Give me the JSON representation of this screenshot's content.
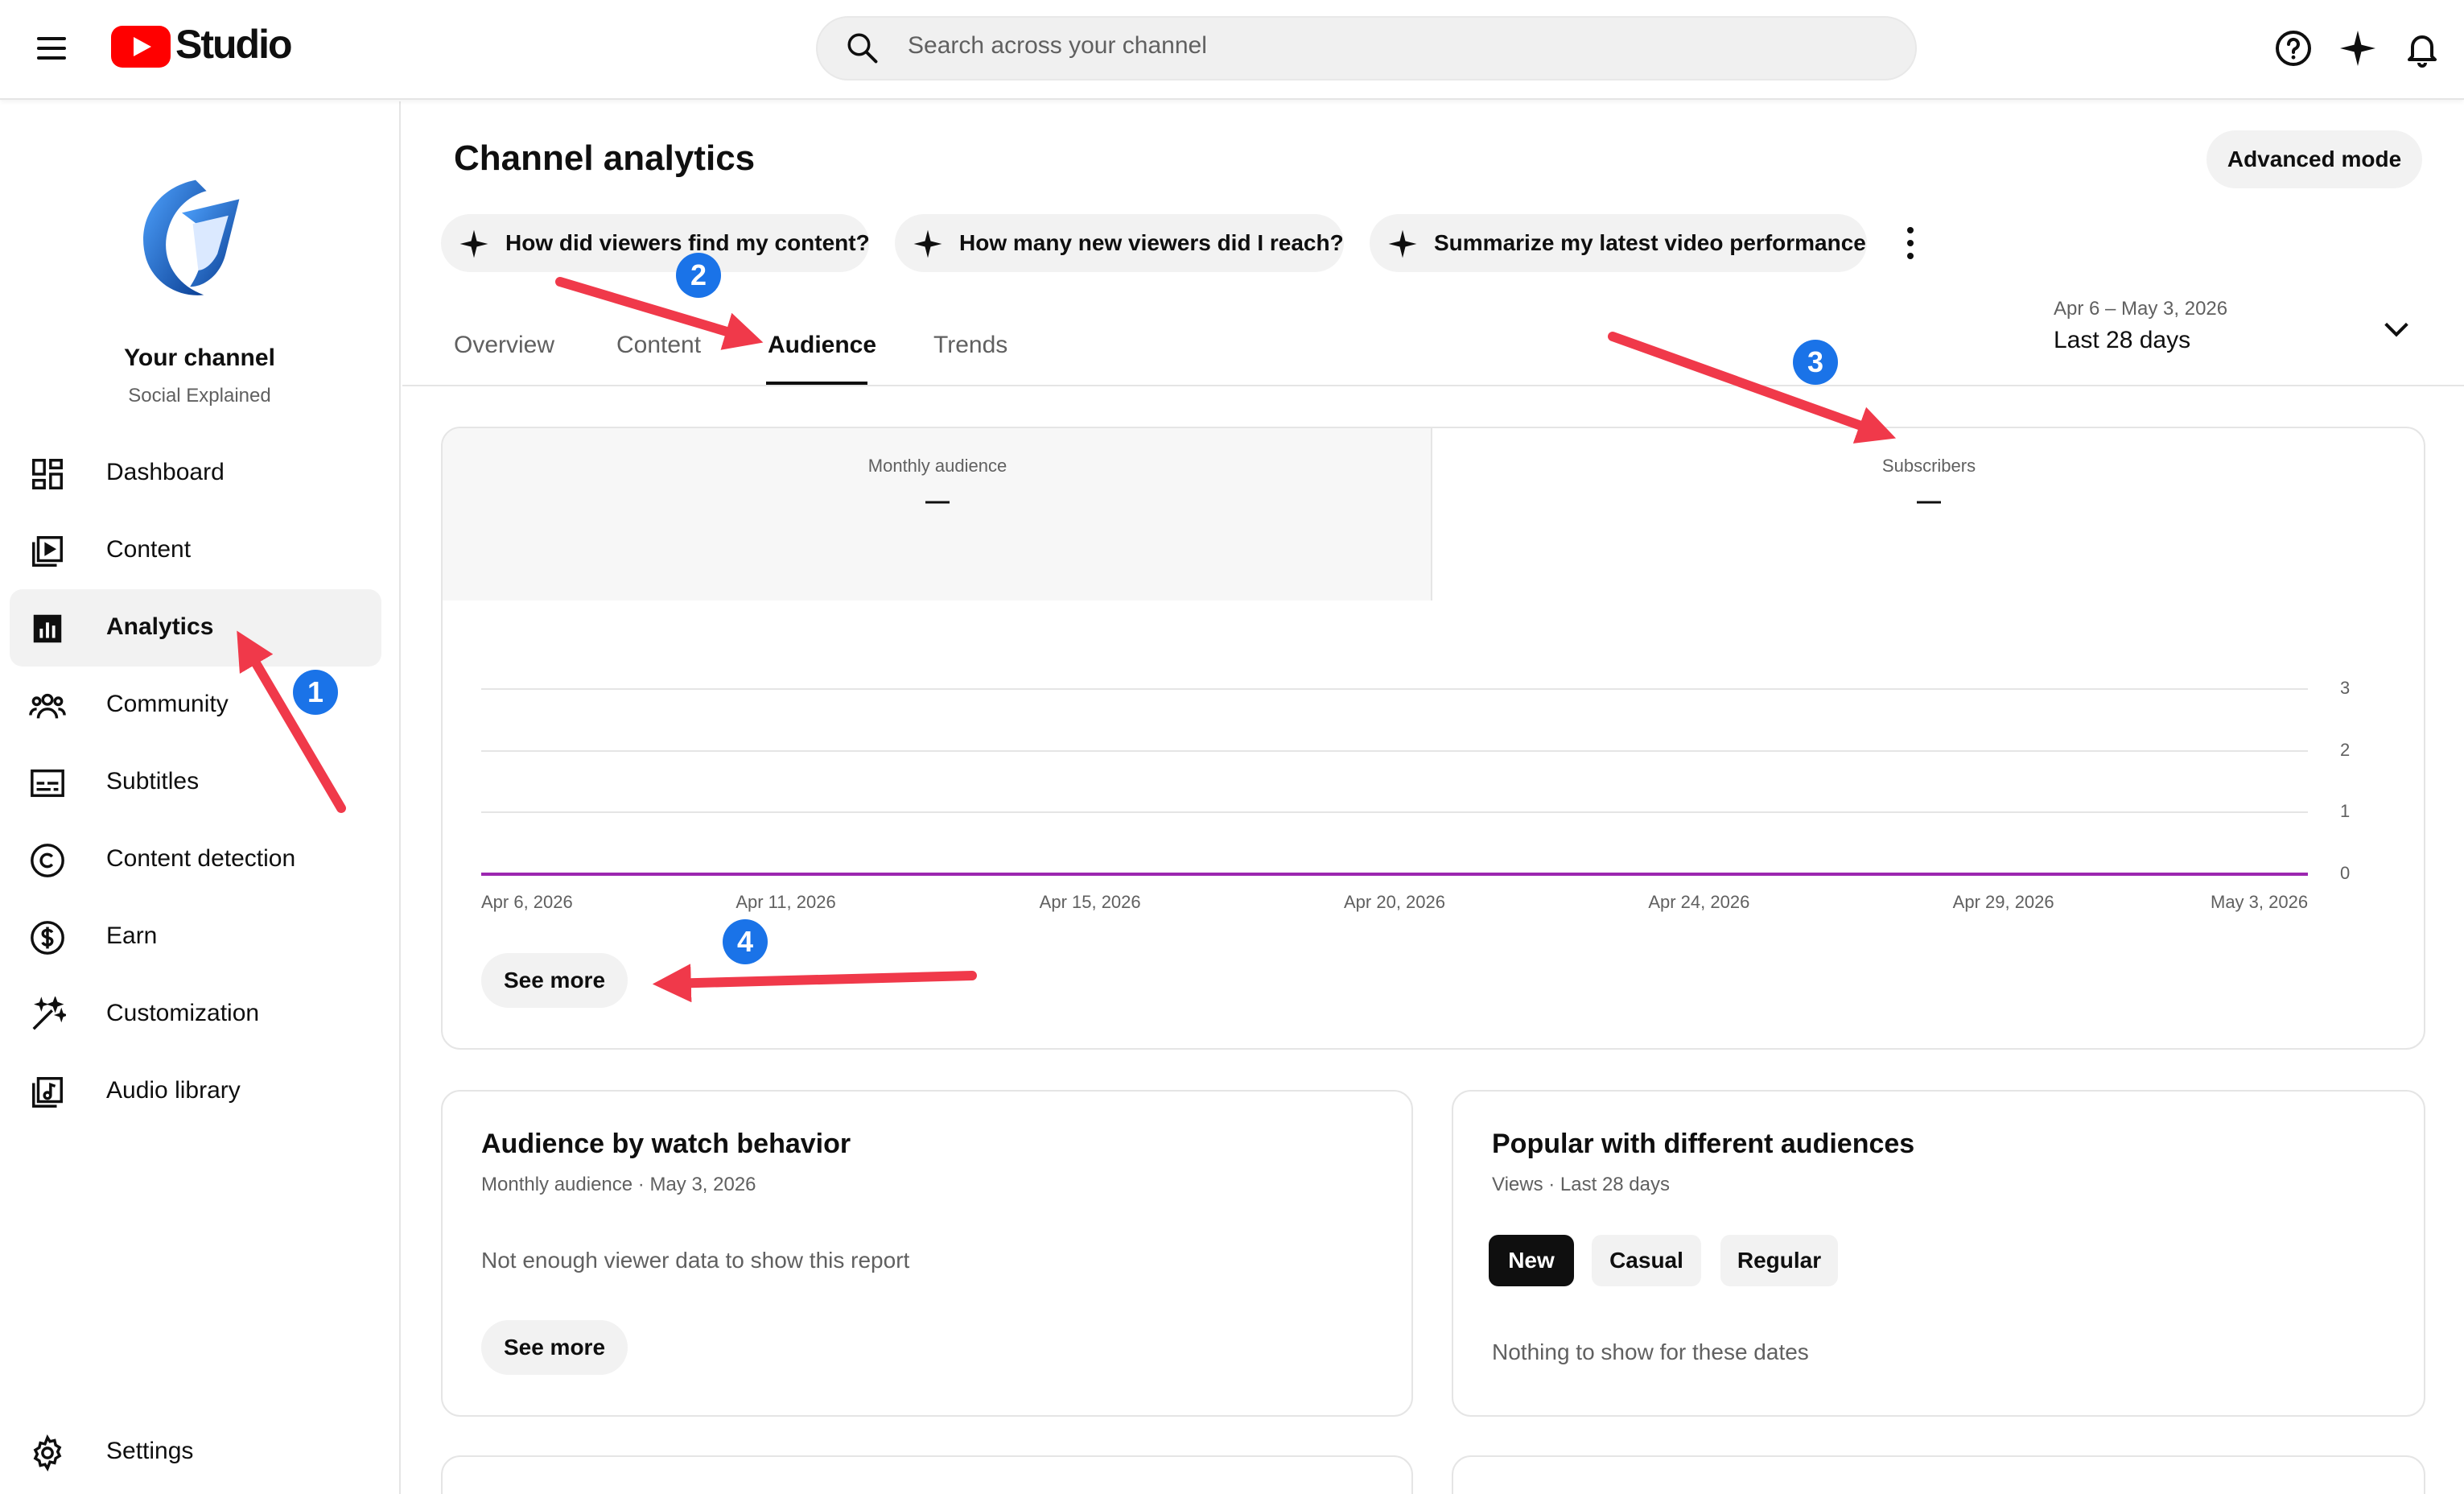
{
  "header": {
    "logo_text": "Studio",
    "search_placeholder": "Search across your channel"
  },
  "sidebar": {
    "channel_name": "Your channel",
    "channel_sub": "Social Explained",
    "items": [
      {
        "label": "Dashboard",
        "icon": "dashboard-icon"
      },
      {
        "label": "Content",
        "icon": "content-icon"
      },
      {
        "label": "Analytics",
        "icon": "analytics-icon",
        "active": true
      },
      {
        "label": "Community",
        "icon": "community-icon"
      },
      {
        "label": "Subtitles",
        "icon": "subtitles-icon"
      },
      {
        "label": "Content detection",
        "icon": "copyright-icon"
      },
      {
        "label": "Earn",
        "icon": "dollar-icon"
      },
      {
        "label": "Customization",
        "icon": "magic-wand-icon"
      },
      {
        "label": "Audio library",
        "icon": "audio-library-icon"
      }
    ],
    "settings_label": "Settings"
  },
  "main": {
    "title": "Channel analytics",
    "advanced_mode": "Advanced mode",
    "chips": [
      "How did viewers find my content?",
      "How many new viewers did I reach?",
      "Summarize my latest video performance"
    ],
    "tabs": [
      "Overview",
      "Content",
      "Audience",
      "Trends"
    ],
    "active_tab": "Audience",
    "date_range": "Apr 6 – May 3, 2026",
    "date_label": "Last 28 days"
  },
  "overview_card": {
    "metrics": [
      {
        "label": "Monthly audience",
        "value": "—"
      },
      {
        "label": "Subscribers",
        "value": "—"
      }
    ],
    "see_more": "See more"
  },
  "chart_data": {
    "type": "line",
    "x": [
      "Apr 6, 2026",
      "Apr 11, 2026",
      "Apr 15, 2026",
      "Apr 20, 2026",
      "Apr 24, 2026",
      "Apr 29, 2026",
      "May 3, 2026"
    ],
    "series": [
      {
        "values": [
          0,
          0,
          0,
          0,
          0,
          0,
          0
        ],
        "color": "#9c27b0"
      }
    ],
    "yticks": [
      "3",
      "2",
      "1",
      "0"
    ],
    "ylim": [
      0,
      3
    ],
    "grid": true
  },
  "watch_behavior_card": {
    "title": "Audience by watch behavior",
    "subtitle": "Monthly audience · May 3, 2026",
    "message": "Not enough viewer data to show this report",
    "see_more": "See more"
  },
  "popular_card": {
    "title": "Popular with different audiences",
    "subtitle": "Views · Last 28 days",
    "segments": [
      "New",
      "Casual",
      "Regular"
    ],
    "active_segment": "New",
    "message": "Nothing to show for these dates"
  },
  "annotations": [
    "1",
    "2",
    "3",
    "4"
  ],
  "colors": {
    "annotation_arrow": "#f0394a",
    "annotation_badge": "#1a73e8",
    "brand_red": "#ff0000"
  }
}
